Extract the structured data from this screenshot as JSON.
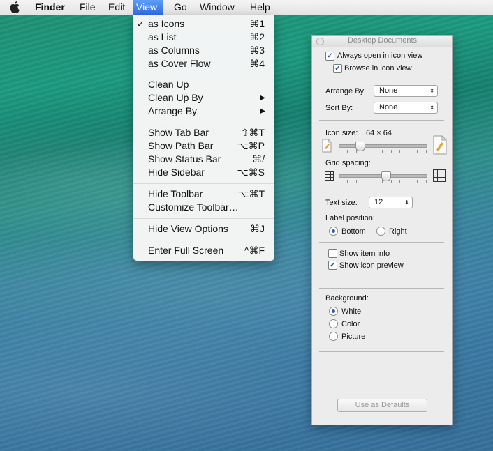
{
  "menubar": {
    "apple_icon": "apple-logo-icon",
    "items": [
      {
        "label": "Finder"
      },
      {
        "label": "File"
      },
      {
        "label": "Edit"
      },
      {
        "label": "View"
      },
      {
        "label": "Go"
      },
      {
        "label": "Window"
      },
      {
        "label": "Help"
      }
    ]
  },
  "view_menu": {
    "items": [
      {
        "label": "as Icons",
        "shortcut": "⌘1",
        "check": "✓"
      },
      {
        "label": "as List",
        "shortcut": "⌘2"
      },
      {
        "label": "as Columns",
        "shortcut": "⌘3"
      },
      {
        "label": "as Cover Flow",
        "shortcut": "⌘4"
      },
      {
        "label": "Clean Up"
      },
      {
        "label": "Clean Up By",
        "arrow": "▶"
      },
      {
        "label": "Arrange By",
        "arrow": "▶"
      },
      {
        "label": "Show Tab Bar",
        "shortcut": "⇧⌘T"
      },
      {
        "label": "Show Path Bar",
        "shortcut": "⌥⌘P"
      },
      {
        "label": "Show Status Bar",
        "shortcut": "⌘/"
      },
      {
        "label": "Hide Sidebar",
        "shortcut": "⌥⌘S"
      },
      {
        "label": "Hide Toolbar",
        "shortcut": "⌥⌘T"
      },
      {
        "label": "Customize Toolbar…"
      },
      {
        "label": "Hide View Options",
        "shortcut": "⌘J"
      },
      {
        "label": "Enter Full Screen",
        "shortcut": "^⌘F"
      }
    ]
  },
  "panel": {
    "title": "Desktop Documents",
    "always_open": {
      "label": "Always open in icon view",
      "checked": true
    },
    "browse": {
      "label": "Browse in icon view",
      "checked": true
    },
    "arrange_by": {
      "label": "Arrange By:",
      "value": "None"
    },
    "sort_by": {
      "label": "Sort By:",
      "value": "None"
    },
    "icon_size": {
      "label": "Icon size:",
      "value": "64 × 64"
    },
    "grid_spacing": {
      "label": "Grid spacing:"
    },
    "text_size": {
      "label": "Text size:",
      "value": "12"
    },
    "label_position": {
      "label": "Label position:",
      "options": [
        {
          "label": "Bottom",
          "selected": true
        },
        {
          "label": "Right",
          "selected": false
        }
      ]
    },
    "show_item_info": {
      "label": "Show item info",
      "checked": false
    },
    "show_icon_preview": {
      "label": "Show icon preview",
      "checked": true
    },
    "background": {
      "label": "Background:",
      "options": [
        {
          "label": "White",
          "selected": true
        },
        {
          "label": "Color",
          "selected": false
        },
        {
          "label": "Picture",
          "selected": false
        }
      ]
    },
    "defaults_button": "Use as Defaults",
    "checkmark_glyph": "✓",
    "popup_arrow_glyph": "⬍"
  }
}
